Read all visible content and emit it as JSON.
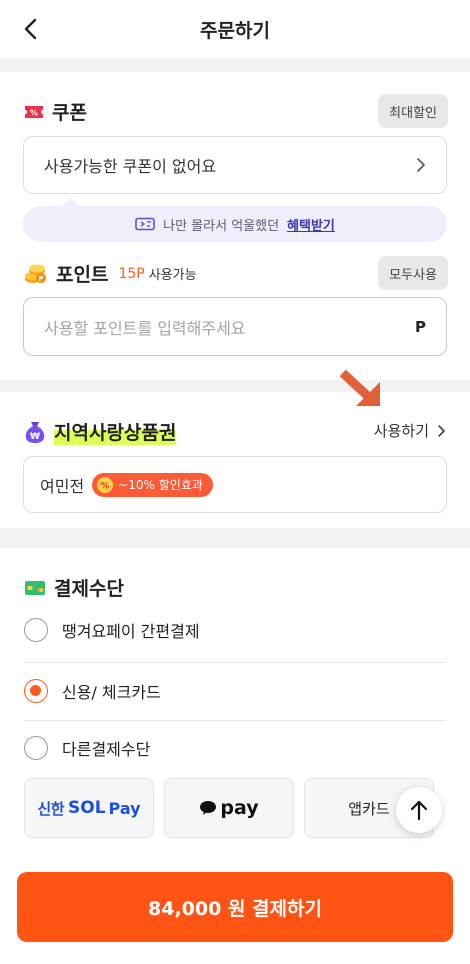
{
  "header": {
    "title": "주문하기",
    "back_icon": "chevron-left-icon"
  },
  "coupon": {
    "title": "쿠폰",
    "max_discount_label": "최대할인",
    "status_text": "사용가능한 쿠폰이 없어요",
    "banner_text": "나만 몰라서 억울했던",
    "banner_link": "혜택받기",
    "accent": "#e8344a"
  },
  "points": {
    "title": "포인트",
    "available_amount": "15P",
    "available_label": "사용가능",
    "use_all_label": "모두사용",
    "input_placeholder": "사용할 포인트를 입력해주세요",
    "unit": "P"
  },
  "local_voucher": {
    "title": "지역사랑상품권",
    "use_label": "사용하기",
    "voucher_name": "여민전",
    "badge_text": "~10% 할인효과",
    "highlight_color": "#dcff5a",
    "badge_color": "#ff5a36",
    "arrow_color": "#e0603a"
  },
  "payment": {
    "title": "결제수단",
    "options": [
      {
        "label": "땡겨요페이 간편결제",
        "selected": false
      },
      {
        "label": "신용/ 체크카드",
        "selected": true
      },
      {
        "label": "다른결제수단",
        "selected": false
      }
    ],
    "methods": [
      {
        "label_a": "신한",
        "label_b": "SOL",
        "label_c": "Pay"
      },
      {
        "label": "pay"
      },
      {
        "label": "앱카드"
      }
    ]
  },
  "footer": {
    "pay_button_label": "84,000 원 결제하기",
    "accent": "#ff5414"
  }
}
